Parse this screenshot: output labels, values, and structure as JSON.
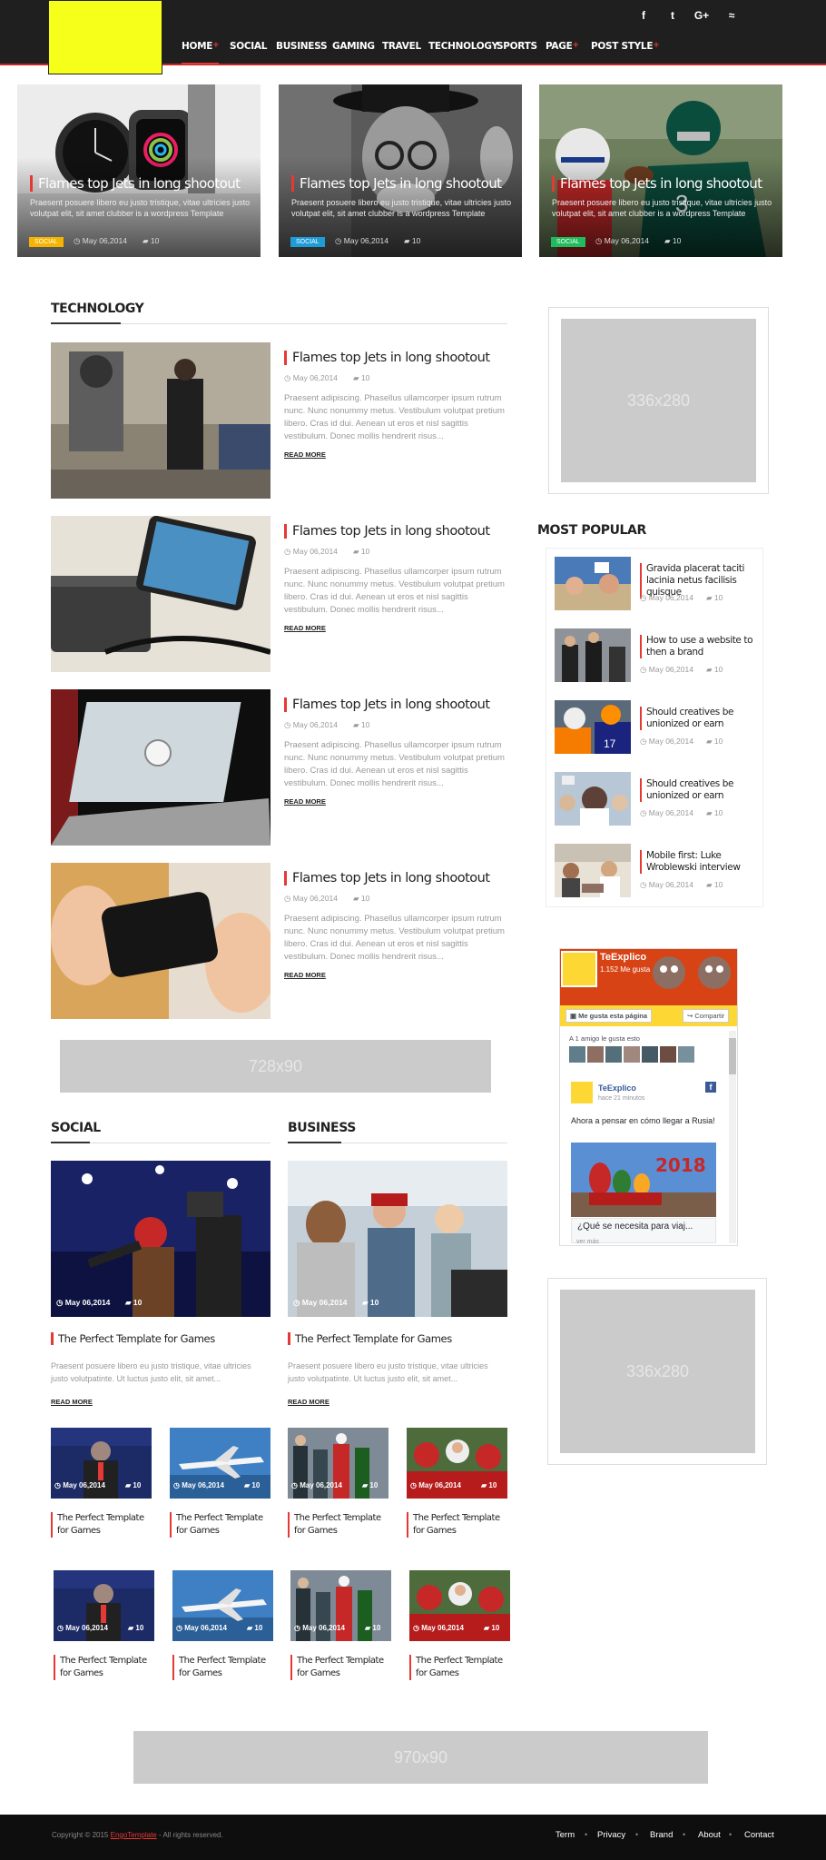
{
  "header": {
    "nav": [
      {
        "label": "HOME",
        "plus": "+"
      },
      {
        "label": "SOCIAL",
        "plus": ""
      },
      {
        "label": "BUSINESS",
        "plus": ""
      },
      {
        "label": "GAMING",
        "plus": ""
      },
      {
        "label": "TRAVEL",
        "plus": ""
      },
      {
        "label": "TECHNOLOGY",
        "plus": ""
      },
      {
        "label": "SPORTS",
        "plus": ""
      },
      {
        "label": "PAGE",
        "plus": "+"
      },
      {
        "label": "POST STYLE",
        "plus": "+"
      }
    ],
    "social_icons": [
      "facebook-icon",
      "twitter-icon",
      "google-plus-icon",
      "rss-icon"
    ],
    "social_glyphs": [
      "f",
      "t",
      "G+",
      "≈"
    ],
    "accent_color": "#e53935",
    "logo_color": "#f5ff1a"
  },
  "hero": [
    {
      "title": "Flames top Jets in long shootout",
      "excerpt": "Praesent posuere libero eu justo tristique, vitae ultricies justo volutpat elit, sit amet clubber is a wordpress Template",
      "badge": "SOCIAL",
      "badge_color": "#f5b400",
      "date": "May 06,2014",
      "comments": "10"
    },
    {
      "title": "Flames top Jets in long shootout",
      "excerpt": "Praesent posuere libero eu justo tristique, vitae ultricies justo volutpat elit, sit amet clubber is a wordpress Template",
      "badge": "SOCIAL",
      "badge_color": "#1e9cd8",
      "date": "May 06,2014",
      "comments": "10"
    },
    {
      "title": "Flames top Jets in long shootout",
      "excerpt": "Praesent posuere libero eu justo tristique, vitae ultricies justo volutpat elit, sit amet clubber is a wordpress Template",
      "badge": "SOCIAL",
      "badge_color": "#1ebc5c",
      "date": "May 06,2014",
      "comments": "10"
    }
  ],
  "technology": {
    "heading": "TECHNOLOGY",
    "posts": [
      {
        "title": "Flames top Jets in long shootout",
        "date": "May 06,2014",
        "comments": "10",
        "excerpt": "Praesent adipiscing. Phasellus ullamcorper ipsum rutrum nunc. Nunc nonummy metus. Vestibulum volutpat pretium libero. Cras id dui. Aenean ut eros et nisl sagittis vestibulum. Donec mollis hendrerit risus...",
        "read_more": "READ MORE"
      },
      {
        "title": "Flames top Jets in long shootout",
        "date": "May 06,2014",
        "comments": "10",
        "excerpt": "Praesent adipiscing. Phasellus ullamcorper ipsum rutrum nunc. Nunc nonummy metus. Vestibulum volutpat pretium libero. Cras id dui. Aenean ut eros et nisl sagittis vestibulum. Donec mollis hendrerit risus...",
        "read_more": "READ MORE"
      },
      {
        "title": "Flames top Jets in long shootout",
        "date": "May 06,2014",
        "comments": "10",
        "excerpt": "Praesent adipiscing. Phasellus ullamcorper ipsum rutrum nunc. Nunc nonummy metus. Vestibulum volutpat pretium libero. Cras id dui. Aenean ut eros et nisl sagittis vestibulum. Donec mollis hendrerit risus...",
        "read_more": "READ MORE"
      },
      {
        "title": "Flames top Jets in long shootout",
        "date": "May 06,2014",
        "comments": "10",
        "excerpt": "Praesent adipiscing. Phasellus ullamcorper ipsum rutrum nunc. Nunc nonummy metus. Vestibulum volutpat pretium libero. Cras id dui. Aenean ut eros et nisl sagittis vestibulum. Donec mollis hendrerit risus...",
        "read_more": "READ MORE"
      }
    ]
  },
  "ads": {
    "sidebar_top": "336x280",
    "leaderboard": "728x90",
    "sidebar_bottom": "336x280",
    "bottom_banner": "970x90"
  },
  "most_popular": {
    "heading": "MOST POPULAR",
    "items": [
      {
        "title": "Gravida placerat taciti lacinia netus facilisis quisque",
        "date": "May 06,2014",
        "comments": "10"
      },
      {
        "title": "How to use a website to then a brand",
        "date": "May 06,2014",
        "comments": "10"
      },
      {
        "title": "Should creatives be unionized or earn",
        "date": "May 06,2014",
        "comments": "10"
      },
      {
        "title": "Should creatives be unionized or earn",
        "date": "May 06,2014",
        "comments": "10"
      },
      {
        "title": "Mobile first: Luke Wroblewski interview",
        "date": "May 06,2014",
        "comments": "10"
      }
    ]
  },
  "facebook": {
    "page_name": "TeExplico",
    "likes": "1.152 Me gusta",
    "like_button": "Me gusta esta página",
    "share_button": "Compartir",
    "friend_likes": "A 1 amigo le gusta esto",
    "post_author": "TeExplico",
    "post_time": "hace 21 minutos",
    "post_text": "Ahora a pensar en cómo llegar a Rusia!",
    "banner_year": "2018",
    "link_title": "¿Qué se necesita para viaj...",
    "see_more": "ver más"
  },
  "social": {
    "heading": "SOCIAL",
    "date": "May 06,2014",
    "comments": "10",
    "title": "The Perfect Template for Games",
    "excerpt": "Praesent posuere libero eu justo tristique, vitae ultricies justo volutpatinte. Ut luctus justo elit, sit amet...",
    "read_more": "READ MORE"
  },
  "business": {
    "heading": "BUSINESS",
    "date": "May 06,2014",
    "comments": "10",
    "title": "The Perfect Template for Games",
    "excerpt": "Praesent posuere libero eu justo tristique, vitae ultricies justo volutpatinte. Ut luctus justo elit, sit amet...",
    "read_more": "READ MORE"
  },
  "grid": {
    "items": [
      {
        "date": "May 06,2014",
        "comments": "10",
        "title": "The Perfect Template for Games"
      },
      {
        "date": "May 06,2014",
        "comments": "10",
        "title": "The Perfect Template for Games"
      },
      {
        "date": "May 06,2014",
        "comments": "10",
        "title": "The Perfect Template for Games"
      },
      {
        "date": "May 06,2014",
        "comments": "10",
        "title": "The Perfect Template for Games"
      },
      {
        "date": "May 06,2014",
        "comments": "10",
        "title": "The Perfect Template for Games"
      },
      {
        "date": "May 06,2014",
        "comments": "10",
        "title": "The Perfect Template for Games"
      },
      {
        "date": "May 06,2014",
        "comments": "10",
        "title": "The Perfect Template for Games"
      },
      {
        "date": "May 06,2014",
        "comments": "10",
        "title": "The Perfect Template for Games"
      }
    ]
  },
  "footer": {
    "copyright_prefix": "Copyright © 2015",
    "copyright_brand": "EngoTemplate",
    "copyright_suffix": "- All rights reserved.",
    "links": [
      "Term",
      "Privacy",
      "Brand",
      "About",
      "Contact"
    ]
  }
}
